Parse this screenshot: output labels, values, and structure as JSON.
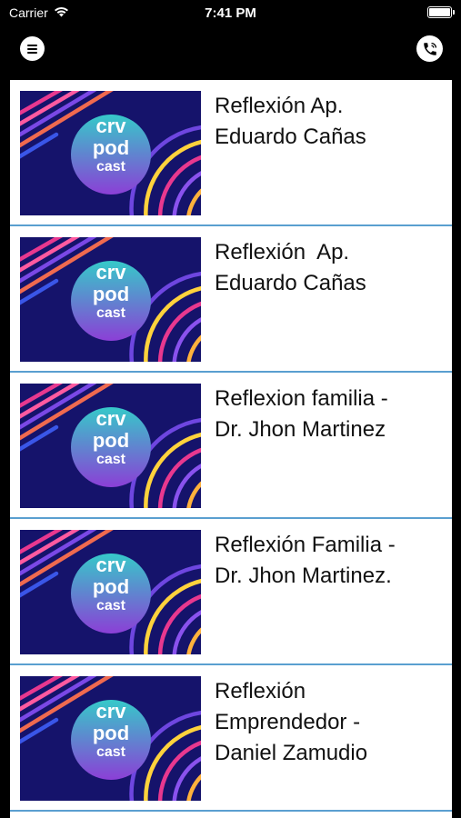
{
  "status_bar": {
    "carrier": "Carrier",
    "time": "7:41 PM",
    "icons": [
      "wifi-icon",
      "battery-icon"
    ]
  },
  "nav": {
    "left_icon": "menu-icon",
    "right_icon": "phone-call-icon"
  },
  "podcast_logo": {
    "line1": "crv",
    "line2": "pod",
    "line3": "cast"
  },
  "colors": {
    "thumb_background": "#15136b",
    "row_divider": "#5a9fd0",
    "logo_gradient_top": "#36c9c9",
    "logo_gradient_bottom": "#8b3fd6"
  },
  "episodes": [
    {
      "title": "Reflexión Ap.\nEduardo Cañas"
    },
    {
      "title": "Reflexión  Ap.\nEduardo Cañas"
    },
    {
      "title": "Reflexion familia -\nDr. Jhon Martinez"
    },
    {
      "title": "Reflexión Familia -\nDr. Jhon Martinez."
    },
    {
      "title": "Reflexión\nEmprendedor -\nDaniel Zamudio"
    }
  ]
}
